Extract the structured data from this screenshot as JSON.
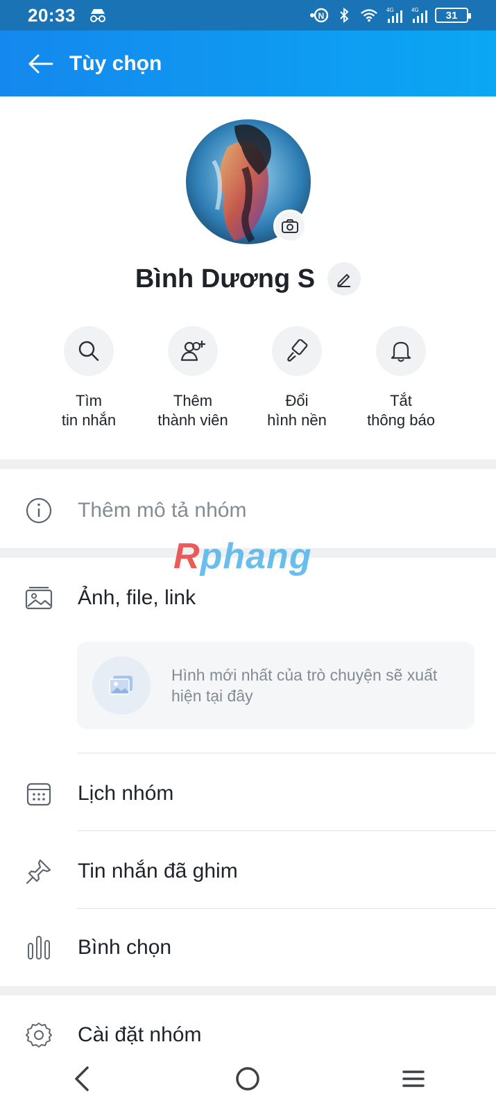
{
  "status_bar": {
    "time": "20:33",
    "battery": "31",
    "icons": [
      "incognito-icon",
      "nfc-icon",
      "bluetooth-icon",
      "wifi-icon",
      "signal-4g-icon",
      "signal-4g-icon",
      "battery-icon"
    ]
  },
  "header": {
    "title": "Tùy chọn",
    "back_icon": "arrow-left-icon"
  },
  "profile": {
    "name": "Bình Dương S"
  },
  "actions": [
    {
      "label": "Tìm\ntin nhắn",
      "icon": "search-icon"
    },
    {
      "label": "Thêm\nthành viên",
      "icon": "add-member-icon"
    },
    {
      "label": "Đổi\nhình nền",
      "icon": "paint-brush-icon"
    },
    {
      "label": "Tắt\nthông báo",
      "icon": "bell-icon"
    }
  ],
  "description": {
    "label": "Thêm mô tả nhóm",
    "icon": "info-icon"
  },
  "media": {
    "label": "Ảnh, file, link",
    "empty_text": "Hình mới nhất của trò chuyện sẽ xuất hiện tại đây"
  },
  "menu": [
    {
      "label": "Lịch nhóm",
      "icon": "calendar-icon"
    },
    {
      "label": "Tin nhắn đã ghim",
      "icon": "pin-icon"
    },
    {
      "label": "Bình chọn",
      "icon": "poll-icon"
    },
    {
      "label": "Cài đặt nhóm",
      "icon": "gear-icon"
    }
  ],
  "watermark": {
    "first": "R",
    "rest": "phang"
  },
  "colors": {
    "header_start": "#1488ee",
    "header_end": "#0ba7f3",
    "status_bar": "#1a73b5",
    "icon_gray": "#5d6670"
  }
}
